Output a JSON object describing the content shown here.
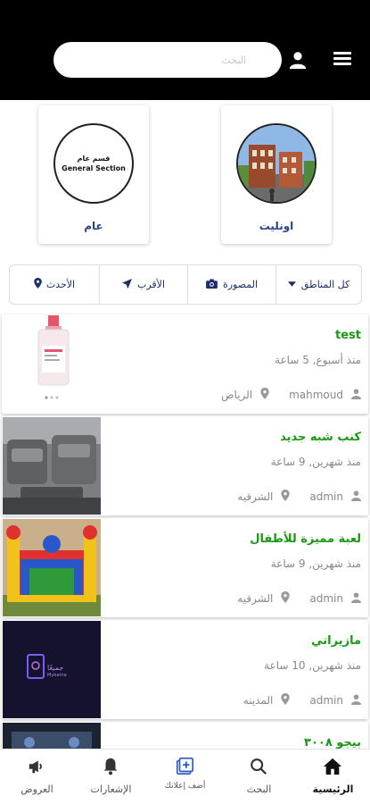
{
  "header": {
    "search_placeholder": "البحث",
    "user_icon": "user-icon",
    "menu_icon": "hamburger-menu-icon"
  },
  "categories": [
    {
      "label": "اونليت",
      "image": "building-photo"
    },
    {
      "label": "عام",
      "logo_line1": "قسم عام",
      "logo_line2": "General Section"
    }
  ],
  "filters": [
    {
      "label": "كل المناطق",
      "icon": "chevron-down-icon"
    },
    {
      "label": "المصورة",
      "icon": "camera-icon"
    },
    {
      "label": "الأقرب",
      "icon": "location-arrow-icon"
    },
    {
      "label": "الأحدث",
      "icon": "map-pin-icon"
    }
  ],
  "listings": [
    {
      "title": "test",
      "time": "منذ أسبوع, 5 ساعة",
      "user": "mahmoud",
      "location": "الرياض",
      "image": "bottle-image"
    },
    {
      "title": "كنب شبه جديد",
      "time": "منذ شهرين, 9 ساعة",
      "user": "admin",
      "location": "الشرقيه",
      "image": "sofa-image"
    },
    {
      "title": "لعبة مميزة للأطفال",
      "time": "منذ شهرين, 9 ساعة",
      "user": "admin",
      "location": "الشرقيه",
      "image": "bouncy-castle-image"
    },
    {
      "title": "مازيراتي",
      "time": "منذ شهرين, 10 ساعة",
      "user": "admin",
      "location": "المدينه",
      "image": "dark-logo-image",
      "logo_text": "جميعًا",
      "logo_sub": "Mybatna"
    },
    {
      "title": "بيجو ٣٠٠٨",
      "time": "",
      "user": "",
      "location": "",
      "image": "car-image"
    }
  ],
  "bottom_nav": [
    {
      "label": "العروض",
      "icon": "megaphone-icon"
    },
    {
      "label": "الإشعارات",
      "icon": "bell-icon"
    },
    {
      "label": "أضف إعلانك",
      "icon": "add-ad-icon"
    },
    {
      "label": "البحث",
      "icon": "search-icon"
    },
    {
      "label": "الرئيسية",
      "icon": "home-icon",
      "active": true
    }
  ],
  "colors": {
    "header_bg": "#000000",
    "title_green": "#179a0f",
    "category_label": "#2a3f8f",
    "filter_text": "#1c2e6e",
    "meta_gray": "#888888"
  }
}
